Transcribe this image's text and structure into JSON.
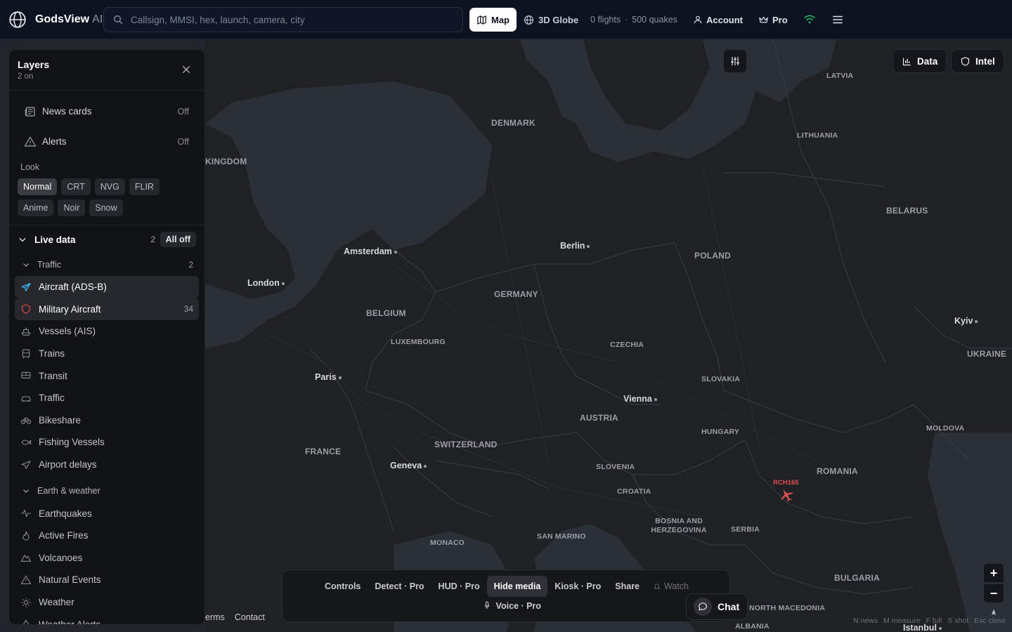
{
  "app": {
    "name": "GodsView",
    "suffix": "AI"
  },
  "search": {
    "placeholder": "Callsign, MMSI, hex, launch, camera, city"
  },
  "view_toggle": {
    "map_label": "Map",
    "globe_label": "3D Globe",
    "active": "Map"
  },
  "stats": {
    "flights": "0 flights",
    "separator": "·",
    "quakes": "500 quakes"
  },
  "top_right": {
    "account_label": "Account",
    "pro_label": "Pro"
  },
  "layers": {
    "title": "Layers",
    "subtitle": "2 on",
    "news_cards": {
      "label": "News cards",
      "state": "Off"
    },
    "alerts": {
      "label": "Alerts",
      "state": "Off"
    },
    "look_label": "Look",
    "looks": [
      "Normal",
      "CRT",
      "NVG",
      "FLIR",
      "Anime",
      "Noir",
      "Snow"
    ],
    "active_look": "Normal",
    "live_data": {
      "label": "Live data",
      "count": "2",
      "all_off": "All off"
    },
    "traffic": {
      "label": "Traffic",
      "count": "2",
      "items": [
        {
          "label": "Aircraft (ADS-B)",
          "on": true,
          "count": "",
          "icon": "plane-icon"
        },
        {
          "label": "Military Aircraft",
          "on": true,
          "count": "34",
          "icon": "shield-icon"
        },
        {
          "label": "Vessels (AIS)",
          "on": false,
          "count": "",
          "icon": "ship-icon"
        },
        {
          "label": "Trains",
          "on": false,
          "count": "",
          "icon": "train-icon"
        },
        {
          "label": "Transit",
          "on": false,
          "count": "",
          "icon": "bus-icon"
        },
        {
          "label": "Traffic",
          "on": false,
          "count": "",
          "icon": "car-icon"
        },
        {
          "label": "Bikeshare",
          "on": false,
          "count": "",
          "icon": "bike-icon"
        },
        {
          "label": "Fishing Vessels",
          "on": false,
          "count": "",
          "icon": "fish-icon"
        },
        {
          "label": "Airport delays",
          "on": false,
          "count": "",
          "icon": "plane-delay-icon"
        }
      ]
    },
    "earth_weather": {
      "label": "Earth & weather",
      "items": [
        {
          "label": "Earthquakes",
          "icon": "pulse-icon"
        },
        {
          "label": "Active Fires",
          "icon": "flame-icon"
        },
        {
          "label": "Volcanoes",
          "icon": "mountain-icon"
        },
        {
          "label": "Natural Events",
          "icon": "warning-icon"
        },
        {
          "label": "Weather",
          "icon": "sun-icon"
        },
        {
          "label": "Weather Alerts",
          "icon": "alert-icon"
        }
      ]
    }
  },
  "map": {
    "countries": [
      {
        "name": "DENMARK"
      },
      {
        "name": "LATVIA"
      },
      {
        "name": "LITHUANIA"
      },
      {
        "name": "BELARUS"
      },
      {
        "name": "POLAND"
      },
      {
        "name": "GERMANY"
      },
      {
        "name": "BELGIUM"
      },
      {
        "name": "LUXEMBOURG"
      },
      {
        "name": "CZECHIA"
      },
      {
        "name": "SLOVAKIA"
      },
      {
        "name": "UKRAINE"
      },
      {
        "name": "AUSTRIA"
      },
      {
        "name": "HUNGARY"
      },
      {
        "name": "MOLDOVA"
      },
      {
        "name": "FRANCE"
      },
      {
        "name": "SWITZERLAND"
      },
      {
        "name": "SLOVENIA"
      },
      {
        "name": "ROMANIA"
      },
      {
        "name": "CROATIA"
      },
      {
        "name": "BOSNIA AND HERZEGOVINA"
      },
      {
        "name": "SERBIA"
      },
      {
        "name": "MONACO"
      },
      {
        "name": "SAN MARINO"
      },
      {
        "name": "BULGARIA"
      },
      {
        "name": "NORTH MACEDONIA"
      },
      {
        "name": "ALBANIA"
      },
      {
        "name": "KINGDOM"
      }
    ],
    "cities": [
      "Amsterdam",
      "Berlin",
      "London",
      "Paris",
      "Vienna",
      "Geneva",
      "Kyiv",
      "Istanbul"
    ],
    "aircraft": [
      {
        "callsign": "RCH165",
        "color": "#e05050"
      }
    ]
  },
  "map_controls": {
    "data_label": "Data",
    "intel_label": "Intel",
    "zoom_in": "+",
    "zoom_out": "−"
  },
  "bottom_bar": {
    "buttons": [
      "Controls",
      "Detect · Pro",
      "HUD · Pro",
      "Hide media",
      "Kiosk · Pro",
      "Share",
      "Watch"
    ],
    "active": "Hide media",
    "voice": "Voice · Pro",
    "chat": "Chat"
  },
  "footer": {
    "links": [
      "erms",
      "Contact"
    ]
  },
  "shortcuts": [
    "N news",
    "M measure",
    "F full",
    "S shot",
    "Esc close"
  ]
}
